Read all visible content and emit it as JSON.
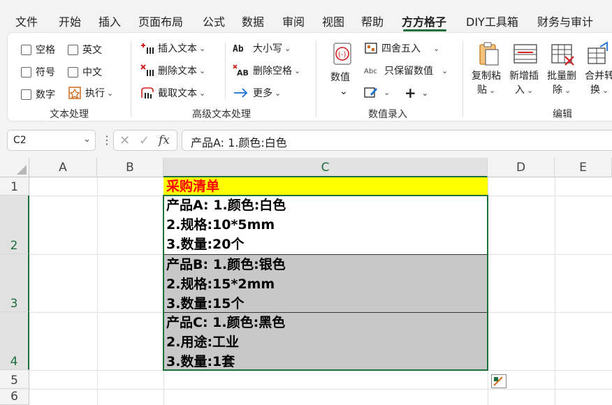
{
  "menu": {
    "items": [
      "文件",
      "开始",
      "插入",
      "页面布局",
      "公式",
      "数据",
      "审阅",
      "视图",
      "帮助",
      "方方格子",
      "DIY工具箱",
      "财务与审计"
    ],
    "active": "方方格子"
  },
  "ribbon": {
    "text_group": {
      "label": "文本处理",
      "checkboxes": [
        "空格",
        "英文",
        "符号",
        "中文",
        "数字"
      ],
      "execute": "执行"
    },
    "adv_text_group": {
      "label": "高级文本处理",
      "insert_text": "插入文本",
      "delete_text": "删除文本",
      "cut_text": "截取文本",
      "case": "大小写",
      "delete_space": "删除空格",
      "more": "更多"
    },
    "number_group": {
      "label": "数值录入",
      "value": "数值",
      "round": "四舍五入",
      "keep_value": "只保留数值"
    },
    "edit_group": {
      "label": "编辑",
      "copy_paste": [
        "复制粘",
        "贴"
      ],
      "add_insert": [
        "新增插",
        "入"
      ],
      "batch_delete": [
        "批量删",
        "除"
      ],
      "merge": [
        "合并转",
        "换"
      ]
    }
  },
  "formula_bar": {
    "name_box": "C2",
    "fx": "fx",
    "content": "产品A: 1.颜色:白色"
  },
  "sheet": {
    "columns": [
      "A",
      "B",
      "C",
      "D",
      "E"
    ],
    "rows": [
      "1",
      "2",
      "3",
      "4",
      "5",
      "6"
    ],
    "selected_column": "C",
    "cells": {
      "c1": "采购清单",
      "c2": [
        "产品A: 1.颜色:白色",
        "2.规格:10*5mm",
        "3.数量:20个"
      ],
      "c3": [
        "产品B: 1.颜色:银色",
        "2.规格:15*2mm",
        "3.数量:15个"
      ],
      "c4": [
        "产品C: 1.颜色:黑色",
        "2.用途:工业",
        "3.数量:1套"
      ]
    }
  },
  "colors": {
    "accent_green": "#1e6f3e",
    "header_fill": "#ffff00",
    "header_text": "#ff0000",
    "row_fill_gray": "#c8c8c8"
  }
}
